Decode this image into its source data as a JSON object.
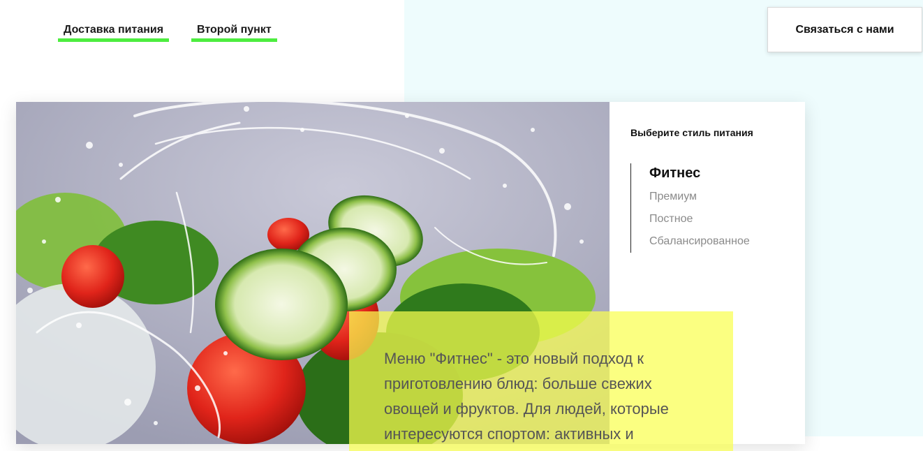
{
  "nav": {
    "items": [
      {
        "label": "Доставка питания"
      },
      {
        "label": "Второй пункт"
      }
    ]
  },
  "contact_button": {
    "label": "Связаться с нами"
  },
  "hero_image": {
    "description": "salad-with-water-splash"
  },
  "style_selector": {
    "title": "Выберите стиль питания",
    "items": [
      {
        "label": "Фитнес",
        "active": true
      },
      {
        "label": "Премиум",
        "active": false
      },
      {
        "label": "Постное",
        "active": false
      },
      {
        "label": "Сбалансированное",
        "active": false
      }
    ]
  },
  "description": {
    "text": "Меню \"Фитнес\" - это новый подход к приготовлению блюд: больше свежих овощей и фруктов. Для людей, которые интересуются спортом: активных и"
  },
  "colors": {
    "accent_underline": "#4ded3f",
    "right_background": "#eefcfd",
    "description_highlight": "#faff50"
  }
}
